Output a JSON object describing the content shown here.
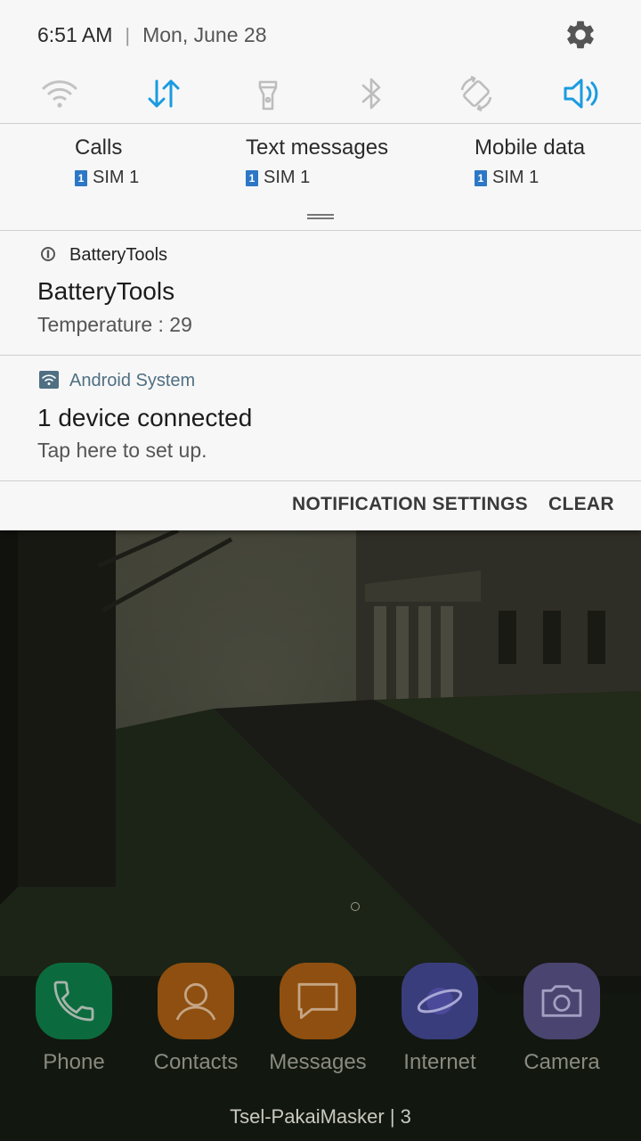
{
  "status_bar": {
    "time": "6:51 AM",
    "separator": "|",
    "date": "Mon, June 28"
  },
  "icons": {
    "settings": "gear-icon",
    "quick_settings": [
      "wifi-icon",
      "mobile-data-icon",
      "flashlight-icon",
      "bluetooth-icon",
      "auto-rotate-icon",
      "sound-icon"
    ]
  },
  "sim": {
    "items": [
      {
        "title": "Calls",
        "badge": "1",
        "sim": "SIM 1"
      },
      {
        "title": "Text messages",
        "badge": "1",
        "sim": "SIM 1"
      },
      {
        "title": "Mobile data",
        "badge": "1",
        "sim": "SIM 1"
      }
    ]
  },
  "notifications": [
    {
      "app": "BatteryTools",
      "title": "BatteryTools",
      "body": "Temperature : 29"
    },
    {
      "app": "Android System",
      "title": "1 device connected",
      "body": "Tap here to set up."
    }
  ],
  "actions": {
    "settings": "NOTIFICATION SETTINGS",
    "clear": "CLEAR"
  },
  "dock": [
    {
      "label": "Phone",
      "color": "#0c6b3e"
    },
    {
      "label": "Contacts",
      "color": "#8f4f10"
    },
    {
      "label": "Messages",
      "color": "#8f4f10"
    },
    {
      "label": "Internet",
      "color": "#3a3d7c"
    },
    {
      "label": "Camera",
      "color": "#4a4470"
    }
  ],
  "carrier": "Tsel-PakaiMasker | 3",
  "colors": {
    "accent": "#1a9be0",
    "inactive_icon": "#bdbdbd",
    "panel_bg": "#f7f7f7",
    "android_system": "#4f6f82"
  }
}
